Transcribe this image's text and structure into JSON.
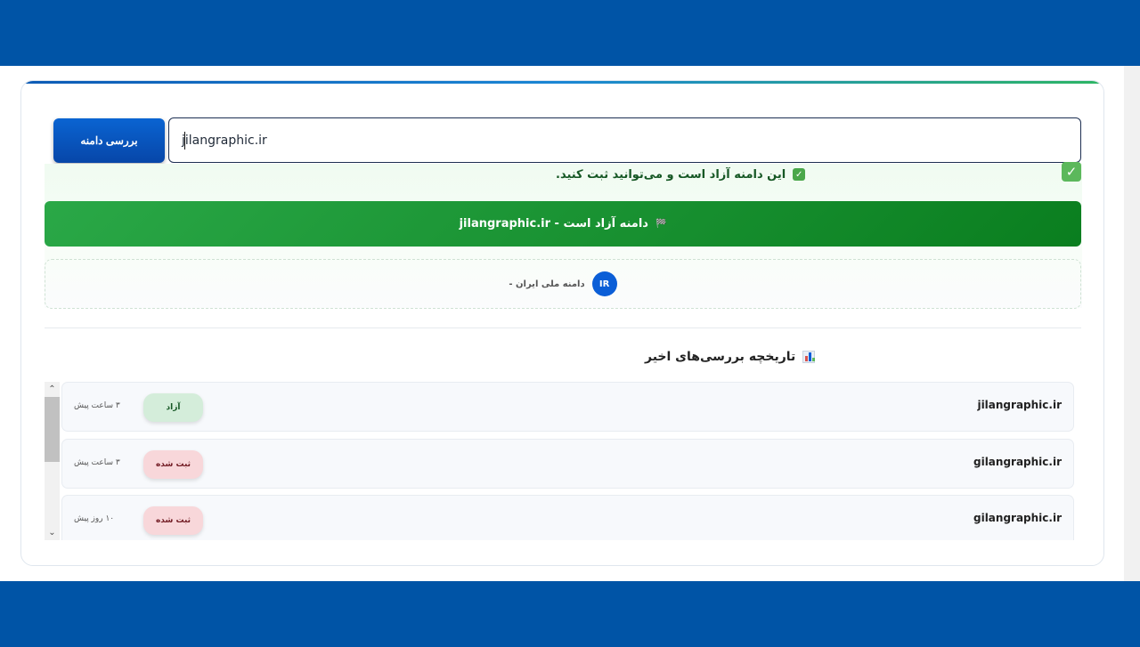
{
  "search": {
    "value": "jilangraphic.ir",
    "button_label": "بررسی دامنه"
  },
  "result": {
    "message": "این دامنه آزاد است و می‌توانید ثبت کنید.",
    "banner": "دامنه آزاد است - jilangraphic.ir",
    "banner_icon": "🏁",
    "tld_badge": "IR",
    "tld_description": "- دامنه ملی ایران"
  },
  "history": {
    "title": "تاریخچه بررسی‌های اخیر",
    "items": [
      {
        "domain": "jilangraphic.ir",
        "status": "آزاد",
        "time": "۳ ساعت پیش"
      },
      {
        "domain": "gilangraphic.ir",
        "status": "ثبت شده",
        "time": "۳ ساعت پیش"
      },
      {
        "domain": "gilangraphic.ir",
        "status": "ثبت شده",
        "time": "۱۰ روز پیش"
      }
    ]
  },
  "colors": {
    "brand": "#0054a6",
    "success": "#1a9a36",
    "free_badge": "#d4edda",
    "taken_badge": "#f8d7da"
  }
}
